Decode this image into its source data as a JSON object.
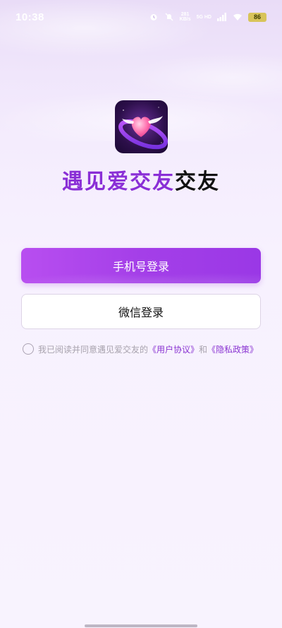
{
  "status_bar": {
    "time": "10:38",
    "net_speed_value": "281",
    "net_speed_unit": "KB/s",
    "signal_label": "5G HD",
    "battery": "86"
  },
  "app": {
    "name_part1": "遇见爱交友",
    "name_part2": "交友"
  },
  "buttons": {
    "phone_login": "手机号登录",
    "wechat_login": "微信登录"
  },
  "agreement": {
    "prefix": "我已阅读并同意遇见爱交友的",
    "user_agreement": "《用户协议》",
    "and": "和",
    "privacy_policy": "《隐私政策》"
  },
  "colors": {
    "accent": "#9a38e6",
    "link": "#8a35d2"
  }
}
